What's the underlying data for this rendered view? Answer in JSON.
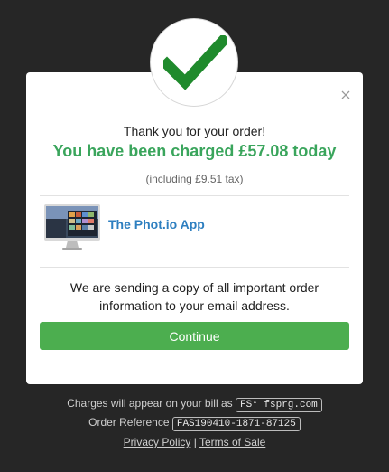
{
  "dialog": {
    "thanks": "Thank you for your order!",
    "charged": "You have been charged £57.08 today",
    "tax": "(including £9.51 tax)",
    "product_name": "The Phot.io App",
    "email_message": "We are sending a copy of all important order information to your email address.",
    "continue_label": "Continue",
    "close_icon": "close-icon",
    "check_icon": "checkmark-icon"
  },
  "footer": {
    "charges_text": "Charges will appear on your bill as",
    "charges_code": "FS* fsprg.com",
    "order_ref_label": "Order Reference",
    "order_ref_code": "FAS190410-1871-87125",
    "privacy_label": "Privacy Policy",
    "separator": "|",
    "terms_label": "Terms of Sale"
  },
  "colors": {
    "background": "#262626",
    "accent_green": "#3aa55c",
    "button_green": "#4cae4f",
    "link_blue": "#2e7fc0"
  }
}
